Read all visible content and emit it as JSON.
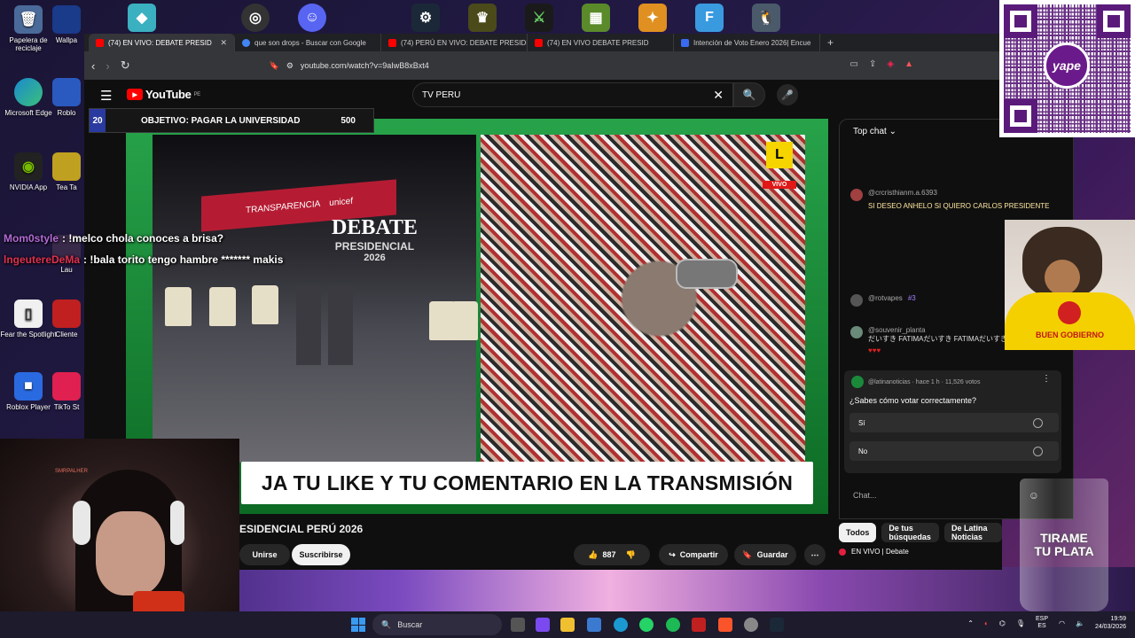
{
  "desktop": {
    "icons_left": [
      {
        "label": "Papelera de reciclaje",
        "icon": "recycle-bin-icon"
      },
      {
        "label": "Microsoft Edge",
        "icon": "edge-icon"
      },
      {
        "label": "NVIDIA App",
        "icon": "nvidia-icon"
      },
      {
        "label": "Fear the Spotlight",
        "icon": "file-icon"
      },
      {
        "label": "Roblox Player",
        "icon": "roblox-icon"
      }
    ],
    "icons_second_col": [
      {
        "label": "Wallpa",
        "icon": "wallpaper-engine-icon"
      },
      {
        "label": "Roblo",
        "icon": "roblox-studio-icon"
      },
      {
        "label": "Tea Ta",
        "icon": "app-icon"
      },
      {
        "label": "Lau",
        "icon": "launcher-icon"
      },
      {
        "label": "Cliente",
        "icon": "client-icon"
      },
      {
        "label": "TikTo St",
        "icon": "tiktok-icon"
      }
    ]
  },
  "browser": {
    "tabs": [
      {
        "label": "(74) EN VIVO: DEBATE PRESID",
        "active": true,
        "color": "#ff0000"
      },
      {
        "label": "que son drops - Buscar con Google",
        "active": false,
        "color": "#4285f4"
      },
      {
        "label": "(74) PERÚ EN VIVO: DEBATE PRESIDE",
        "active": false,
        "color": "#ff0000"
      },
      {
        "label": "(74) EN VIVO DEBATE PRESID",
        "active": false,
        "color": "#ff0000"
      },
      {
        "label": "Intención de Voto Enero 2026| Encue",
        "active": false,
        "color": "#3a6af0"
      }
    ],
    "url": "youtube.com/watch?v=9aIwB8xBxt4"
  },
  "youtube": {
    "logo": "YouTube",
    "region": "PE",
    "search_value": "TV PERU",
    "video": {
      "ticker": "JA TU LIKE Y TU COMENTARIO EN LA TRANSMISIÓN",
      "logo_big": "DEBATE",
      "logo_mid": "PRESIDENCIAL",
      "logo_year": "2026",
      "live_badge": "VIVO",
      "banner_text": "TRANSPARENCIA"
    },
    "title": "ESIDENCIAL PERÚ 2026",
    "join_label": "Unirse",
    "subscribe_label": "Suscribirse",
    "likes": "887",
    "share_label": "Compartir",
    "save_label": "Guardar",
    "chips": [
      "Todos",
      "De tus búsquedas",
      "De Latina Noticias"
    ],
    "related_label": "EN VIVO | Debate"
  },
  "chat": {
    "mode": "Top chat",
    "goal": {
      "current": "20",
      "label": "OBJETIVO: PAGAR LA UNIVERSIDAD",
      "target": "500"
    },
    "messages": [
      {
        "user": "@crcristhianm.a.6393",
        "text": "SI DESEO ANHELO SI QUIERO CARLOS PRESIDENTE"
      },
      {
        "user": "@rotvapes",
        "badge": "#3",
        "text": ""
      },
      {
        "user": "@souvenir_planta",
        "text": "だいすき FATIMAだいすき FATIMAだいすき FATIMAだいすき"
      }
    ],
    "poll": {
      "source": "@latinanoticias · hace 1 h · 11,526 votos",
      "question": "¿Sabes cómo votar correctamente?",
      "options": [
        "Sí",
        "No"
      ]
    },
    "input_placeholder": "Chat..."
  },
  "overlay_chat": [
    {
      "user": "Mom0style",
      "text": ": !melco chola conoces a brisa?"
    },
    {
      "user": "lngeutereDeMa",
      "text": ": !bala torito tengo hambre ******* makis"
    }
  ],
  "overlays": {
    "yape_label": "yape",
    "dog_text": "BUEN GOBIERNO",
    "glass_line1": "TIRAME",
    "glass_line2": "TU PLATA",
    "webcam_tag": "SMRPALHER"
  },
  "taskbar": {
    "search_label": "Buscar",
    "lang_top": "ESP",
    "lang_bottom": "ES",
    "time": "19:59",
    "date": "24/03/2026"
  }
}
